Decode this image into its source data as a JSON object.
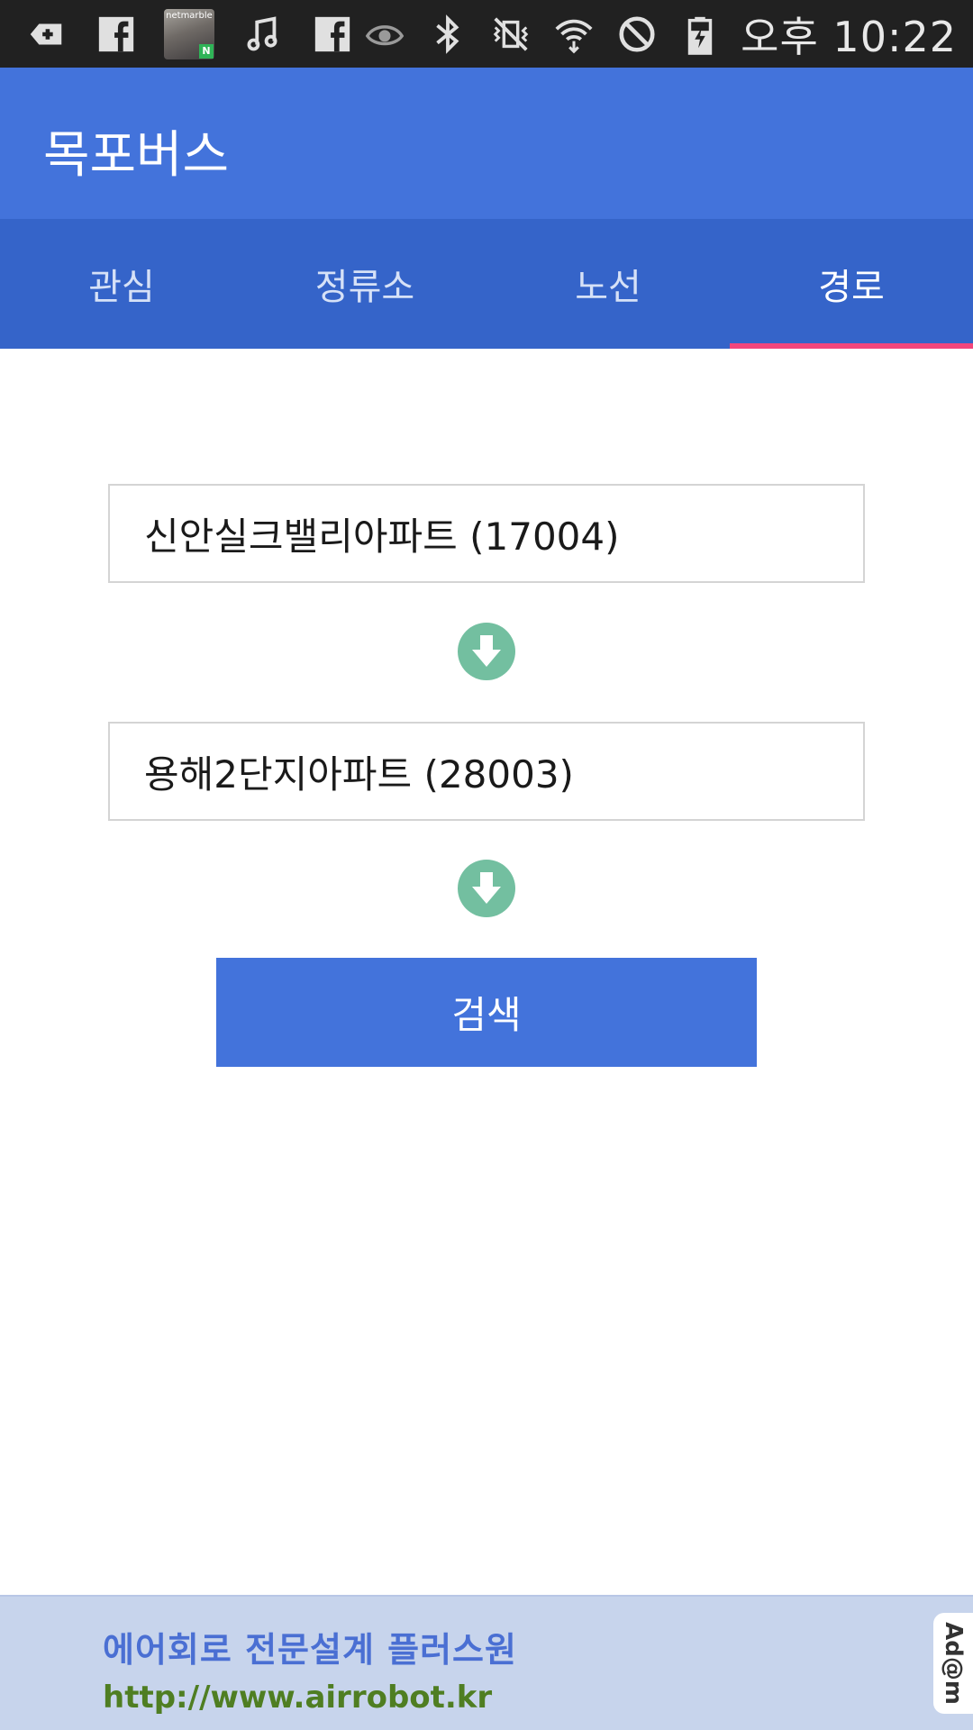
{
  "status_bar": {
    "time": "오후 10:22",
    "notification_icons": [
      "add-box-icon",
      "facebook-icon",
      "netmarble-game-icon",
      "music-note-icon",
      "facebook-icon"
    ],
    "system_icons": [
      "eye-icon",
      "bluetooth-icon",
      "vibrate-icon",
      "wifi-icon",
      "blocked-icon",
      "battery-charging-icon"
    ],
    "thumb_label": "netmarble",
    "thumb_badge": "N"
  },
  "app": {
    "title": "목포버스",
    "accent_color": "#4373db",
    "tab_indicator_color": "#f3467c"
  },
  "tabs": [
    {
      "label": "관심",
      "active": false
    },
    {
      "label": "정류소",
      "active": false
    },
    {
      "label": "노선",
      "active": false
    },
    {
      "label": "경로",
      "active": true
    }
  ],
  "route": {
    "origin": "신안실크밸리아파트 (17004)",
    "destination": "용해2단지아파트 (28003)",
    "search_label": "검색"
  },
  "ad": {
    "title": "에어회로 전문설계 플러스원",
    "url": "http://www.airrobot.kr",
    "logo": "Ad@m"
  }
}
